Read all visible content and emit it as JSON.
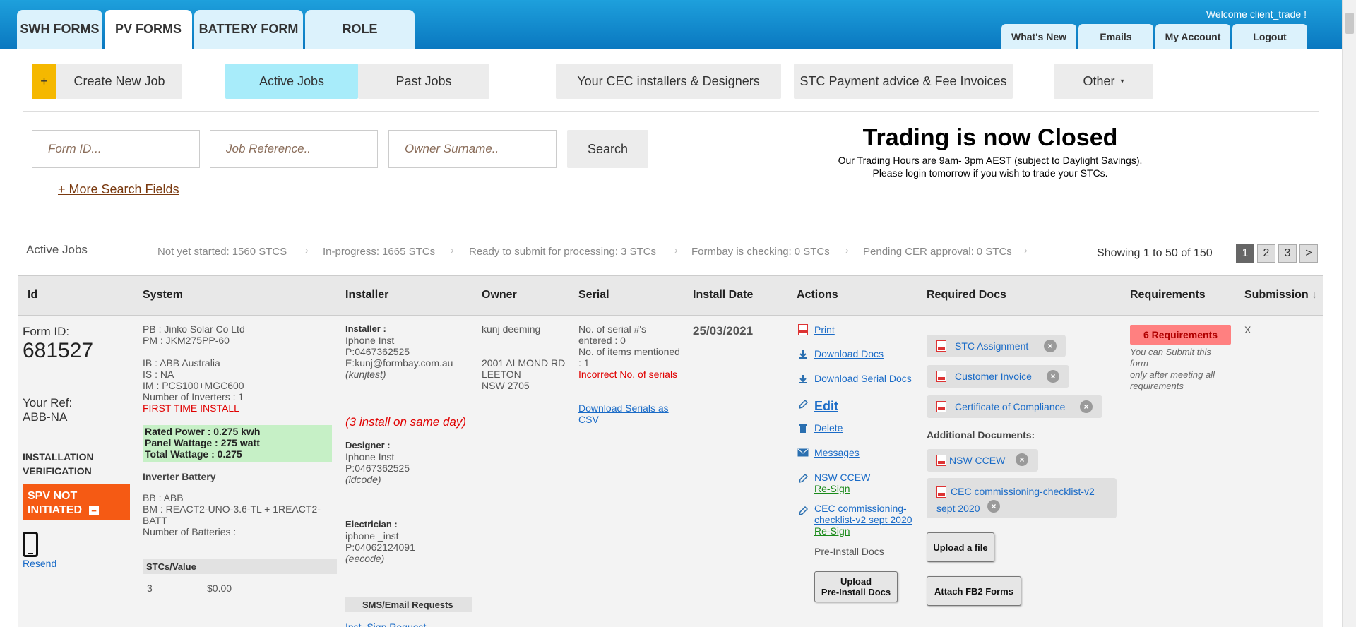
{
  "header": {
    "main_tabs": [
      "SWH FORMS",
      "PV FORMS",
      "BATTERY FORM",
      "ROLE"
    ],
    "active_tab": "PV FORMS",
    "welcome": "Welcome client_trade !",
    "right_tabs": [
      "What's New",
      "Emails",
      "My Account",
      "Logout"
    ]
  },
  "nav": {
    "create_plus": "+",
    "create_new_job": "Create New Job",
    "active_jobs": "Active Jobs",
    "past_jobs": "Past Jobs",
    "installers": "Your CEC installers & Designers",
    "stc_payment": "STC Payment advice & Fee Invoices",
    "other": "Other",
    "other_caret": "▾"
  },
  "search": {
    "form_id_placeholder": "Form ID...",
    "job_ref_placeholder": "Job Reference..",
    "owner_placeholder": "Owner Surname..",
    "button": "Search",
    "more_fields": "+ More Search Fields"
  },
  "trading": {
    "title": "Trading is now Closed",
    "line1": "Our Trading Hours are 9am- 3pm AEST (subject to Daylight Savings).",
    "line2": "Please login tomorrow if you wish to trade your STCs."
  },
  "status": {
    "label": "Active Jobs",
    "items": [
      {
        "label": "Not yet started:",
        "value": "1560 STCS"
      },
      {
        "label": "In-progress:",
        "value": "1665 STCs"
      },
      {
        "label": "Ready to submit for processing:",
        "value": "3 STCs"
      },
      {
        "label": "Formbay is checking:",
        "value": "0 STCs"
      },
      {
        "label": "Pending CER approval:",
        "value": "0 STCs"
      }
    ],
    "chevron": "›",
    "showing": "Showing 1 to 50 of 150",
    "pages": [
      "1",
      "2",
      "3",
      ">"
    ]
  },
  "table": {
    "headers": [
      "Id",
      "System",
      "Installer",
      "Owner",
      "Serial",
      "Install Date",
      "Actions",
      "Required Docs",
      "Requirements",
      "Submission"
    ],
    "sort_icon": "↓"
  },
  "job": {
    "form_id_label": "Form ID:",
    "form_id": "681527",
    "your_ref_label": "Your Ref:",
    "your_ref": "ABB-NA",
    "verification_1": "INSTALLATION",
    "verification_2": "VERIFICATION",
    "spv_1": "SPV NOT",
    "spv_2": "INITIATED",
    "spv_icon": "−",
    "resend": "Resend",
    "system": {
      "pb": "PB : Jinko Solar Co Ltd",
      "pm": "PM : JKM275PP-60",
      "ib": "IB : ABB Australia",
      "is": "IS : NA",
      "im": "IM : PCS100+MGC600",
      "inverters": "Number of Inverters : 1",
      "first_time": "FIRST TIME INSTALL",
      "rated_power": "Rated Power : 0.275 kwh",
      "panel_wattage": "Panel Wattage : 275 watt",
      "total_wattage": "Total Wattage : 0.275",
      "inverter_battery": "Inverter Battery",
      "bb": "BB : ABB",
      "bm1": "BM : REACT2-UNO-3.6-TL + 1REACT2-",
      "bm2": "BATT",
      "batteries": "Number of Batteries :",
      "stcs_header": "STCs/Value",
      "stcs_count": "3",
      "stcs_value": "$0.00"
    },
    "installer": {
      "installer_label": "Installer :",
      "installer_name": "Iphone Inst",
      "installer_phone": "P:0467362525",
      "installer_email": "E:kunj@formbay.com.au",
      "installer_code": "(kunjtest)",
      "same_day": "(3 install on same day)",
      "designer_label": "Designer :",
      "designer_name": "Iphone Inst",
      "designer_phone": "P:0467362525",
      "designer_code": "(idcode)",
      "electrician_label": "Electrician :",
      "electrician_name": "iphone _inst",
      "electrician_phone": "P:04062124091",
      "electrician_code": "(eecode)",
      "sms_header": "SMS/Email Requests",
      "sign_request": "Inst. Sign Request"
    },
    "owner": {
      "name": "kunj deeming",
      "address1": "2001 ALMOND RD",
      "address2": "LEETON",
      "address3": "NSW   2705"
    },
    "serial": {
      "line1": "No. of serial #'s",
      "line2": "entered : 0",
      "line3": "No. of items mentioned",
      "line4": ": 1",
      "incorrect": "Incorrect No. of serials",
      "download1": "Download Serials as",
      "download2": "CSV"
    },
    "install_date": "25/03/2021",
    "actions": {
      "print": "Print",
      "download_docs": "Download Docs",
      "download_serial": "Download Serial Docs",
      "edit": "Edit",
      "delete": "Delete",
      "messages": "Messages",
      "nsw_ccew": "NSW CCEW",
      "resign1": "Re-Sign",
      "cec1": "CEC commissioning-",
      "cec2": "checklist-v2 sept 2020",
      "resign2": "Re-Sign",
      "pre_install": "Pre-Install Docs",
      "upload1": "Upload",
      "upload2": "Pre-Install Docs"
    },
    "required_docs": {
      "stc": "STC Assignment",
      "invoice": "Customer Invoice",
      "certificate": "Certificate of Compliance",
      "additional": "Additional Documents:",
      "nsw": "NSW CCEW",
      "cec1": "CEC commissioning-checklist-v2",
      "cec2": "sept 2020",
      "upload": "Upload a file",
      "attach": "Attach FB2 Forms",
      "x": "×"
    },
    "requirements": {
      "badge": "6 Requirements",
      "note1": "You can Submit this",
      "note2": "form",
      "note3": "only after meeting all",
      "note4": "requirements"
    },
    "submission": "X"
  },
  "colors": {
    "header_blue": "#0a78c0",
    "active_tab_bg": "#a8ecfa",
    "spv_orange": "#f55a14",
    "requirements_red": "#ff4d4d",
    "green_box": "#c6f0c6",
    "create_yellow": "#f5b800"
  },
  "icons": {
    "pdf": "pdf-icon",
    "download": "download-icon",
    "edit": "pencil-icon",
    "delete": "trash-icon",
    "messages": "envelope-icon",
    "phone": "mobile-phone-icon"
  }
}
